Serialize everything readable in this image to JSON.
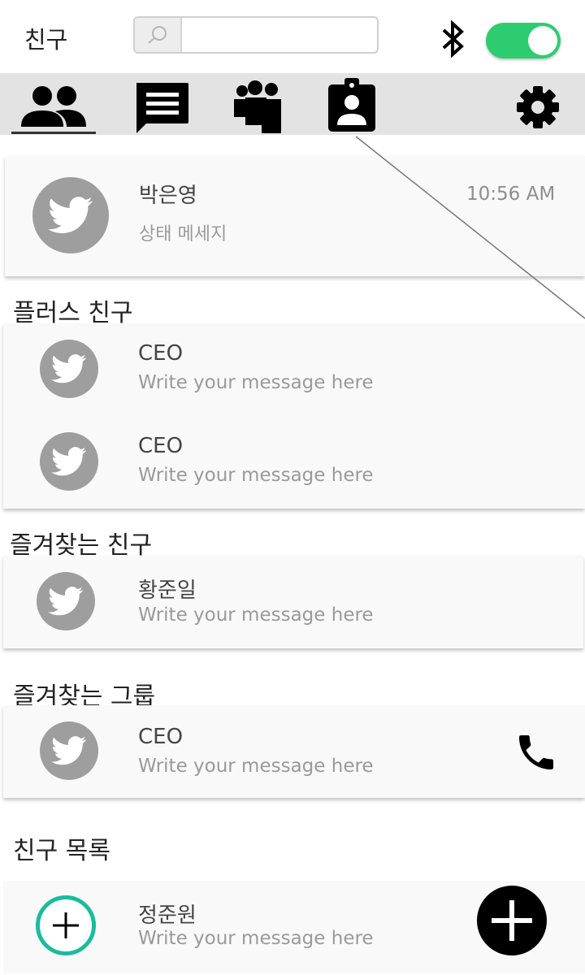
{
  "header": {
    "title": "친구",
    "search_value": "",
    "search_placeholder": "",
    "bluetooth_icon": "bluetooth-icon",
    "toggle_on": true,
    "toggle_color": "#2ecc71"
  },
  "tabs": [
    {
      "icon": "friends-icon",
      "active": true
    },
    {
      "icon": "chat-icon",
      "active": false
    },
    {
      "icon": "group-icon",
      "active": false
    },
    {
      "icon": "contact-card-icon",
      "active": false
    },
    {
      "icon": "gear-icon",
      "active": false
    }
  ],
  "profile": {
    "name": "박은영",
    "status": "상태 메세지",
    "time": "10:56 AM"
  },
  "sections": {
    "plus_friends": {
      "title": "플러스 친구",
      "items": [
        {
          "name": "CEO",
          "message": "Write your message here"
        },
        {
          "name": "CEO",
          "message": "Write your message here"
        }
      ]
    },
    "favorite_friends": {
      "title": "즐겨찾는 친구",
      "items": [
        {
          "name": "황준일",
          "message": "Write your message here"
        }
      ]
    },
    "favorite_groups": {
      "title": "즐겨찾는 그룹",
      "items": [
        {
          "name": "CEO",
          "message": "Write your message here"
        }
      ]
    },
    "friend_list": {
      "title": "친구 목록",
      "items": [
        {
          "name": "정준원",
          "message": "Write your message here"
        }
      ]
    }
  },
  "colors": {
    "accent_green": "#2ecc71",
    "add_ring": "#1abc9c",
    "avatar_gray": "#9e9e9e",
    "tabbar_bg": "#e3e3e3"
  }
}
